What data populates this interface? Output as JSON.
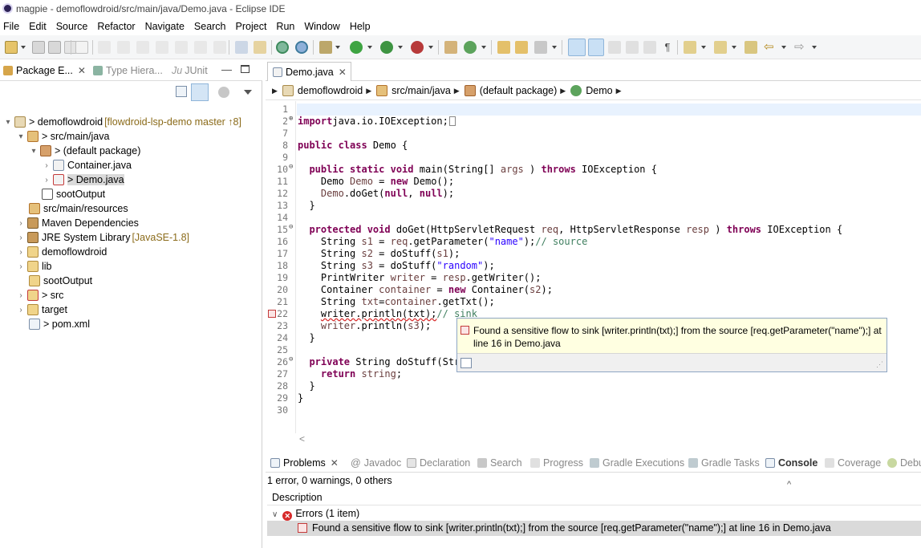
{
  "window": {
    "title": "magpie - demoflowdroid/src/main/java/Demo.java - Eclipse IDE"
  },
  "menu": [
    "File",
    "Edit",
    "Source",
    "Refactor",
    "Navigate",
    "Search",
    "Project",
    "Run",
    "Window",
    "Help"
  ],
  "left_panel": {
    "tabs": [
      {
        "label": "Package E...",
        "active": true
      },
      {
        "label": "Type Hiera...",
        "active": false
      },
      {
        "label": "JUnit",
        "active": false,
        "icon_text": "Ju"
      }
    ],
    "tree": [
      {
        "label": "> demoflowdroid",
        "decoration": "[flowdroid-lsp-demo master ↑8]",
        "arrow": "▾",
        "icon": "java-project-icon"
      },
      {
        "label": "> src/main/java",
        "arrow": "▾",
        "icon": "source-folder-icon"
      },
      {
        "label": "> (default package)",
        "arrow": "▾",
        "icon": "package-icon"
      },
      {
        "label": "Container.java",
        "arrow": "›",
        "icon": "java-file-icon"
      },
      {
        "label": "> Demo.java",
        "arrow": "›",
        "icon": "java-file-error-icon"
      },
      {
        "label": "sootOutput",
        "arrow": "",
        "icon": "folder-grid-icon"
      },
      {
        "label": "src/main/resources",
        "arrow": "",
        "icon": "source-folder-icon"
      },
      {
        "label": "Maven Dependencies",
        "arrow": "›",
        "icon": "library-icon"
      },
      {
        "label": "JRE System Library",
        "decoration": "[JavaSE-1.8]",
        "arrow": "›",
        "icon": "library-icon"
      },
      {
        "label": "demoflowdroid",
        "arrow": "›",
        "icon": "folder-icon"
      },
      {
        "label": "lib",
        "arrow": "›",
        "icon": "folder-icon"
      },
      {
        "label": "sootOutput",
        "arrow": "",
        "icon": "folder-icon"
      },
      {
        "label": "> src",
        "arrow": "›",
        "icon": "folder-error-icon"
      },
      {
        "label": "target",
        "arrow": "›",
        "icon": "folder-icon"
      },
      {
        "label": "> pom.xml",
        "arrow": "",
        "icon": "xml-file-icon"
      }
    ]
  },
  "editor": {
    "tab_label": "Demo.java",
    "breadcrumb": [
      "demoflowdroid",
      "src/main/java",
      "(default package)",
      "Demo"
    ],
    "lines": [
      {
        "n": "1",
        "m": "",
        "s": []
      },
      {
        "n": "2",
        "m": "⊕",
        "s": [
          [
            "kw",
            "import"
          ],
          [
            "",
            "java.io.IOException;"
          ],
          [
            "box",
            ""
          ]
        ]
      },
      {
        "n": "7",
        "m": "",
        "s": []
      },
      {
        "n": "8",
        "m": "",
        "s": [
          [
            "kw",
            "public class"
          ],
          [
            "",
            " Demo {"
          ]
        ]
      },
      {
        "n": "9",
        "m": "",
        "s": []
      },
      {
        "n": "10",
        "m": "⊖",
        "s": [
          [
            "",
            "  "
          ],
          [
            "kw",
            "public static void"
          ],
          [
            "",
            " main(String[] "
          ],
          [
            "var",
            "args"
          ],
          [
            "",
            " ) "
          ],
          [
            "kw",
            "throws"
          ],
          [
            "",
            " IOException {"
          ]
        ]
      },
      {
        "n": "11",
        "m": "",
        "s": [
          [
            "",
            "    Demo "
          ],
          [
            "var",
            "Demo"
          ],
          [
            "",
            " = "
          ],
          [
            "kw",
            "new"
          ],
          [
            "",
            " Demo();"
          ]
        ]
      },
      {
        "n": "12",
        "m": "",
        "s": [
          [
            "",
            "    "
          ],
          [
            "var",
            "Demo"
          ],
          [
            "",
            ".doGet("
          ],
          [
            "kw",
            "null"
          ],
          [
            "",
            ", "
          ],
          [
            "kw",
            "null"
          ],
          [
            "",
            ");"
          ]
        ]
      },
      {
        "n": "13",
        "m": "",
        "s": [
          [
            "",
            "  }"
          ]
        ]
      },
      {
        "n": "14",
        "m": "",
        "s": []
      },
      {
        "n": "15",
        "m": "⊖",
        "s": [
          [
            "",
            "  "
          ],
          [
            "kw",
            "protected void"
          ],
          [
            "",
            " doGet(HttpServletRequest "
          ],
          [
            "var",
            "req"
          ],
          [
            "",
            ", HttpServletResponse "
          ],
          [
            "var",
            "resp"
          ],
          [
            "",
            " ) "
          ],
          [
            "kw",
            "throws"
          ],
          [
            "",
            " IOException {"
          ]
        ]
      },
      {
        "n": "16",
        "m": "",
        "s": [
          [
            "",
            "    String "
          ],
          [
            "var",
            "s1"
          ],
          [
            "",
            " = "
          ],
          [
            "var",
            "req"
          ],
          [
            "",
            ".getParameter("
          ],
          [
            "str",
            "\"name\""
          ],
          [
            "",
            ");"
          ],
          [
            "cm",
            "// source"
          ]
        ]
      },
      {
        "n": "17",
        "m": "",
        "s": [
          [
            "",
            "    String "
          ],
          [
            "var",
            "s2"
          ],
          [
            "",
            " = doStuff("
          ],
          [
            "var",
            "s1"
          ],
          [
            "",
            ");"
          ]
        ]
      },
      {
        "n": "18",
        "m": "",
        "s": [
          [
            "",
            "    String "
          ],
          [
            "var",
            "s3"
          ],
          [
            "",
            " = doStuff("
          ],
          [
            "str",
            "\"random\""
          ],
          [
            "",
            ");"
          ]
        ]
      },
      {
        "n": "19",
        "m": "",
        "s": [
          [
            "",
            "    PrintWriter "
          ],
          [
            "var",
            "writer"
          ],
          [
            "",
            " = "
          ],
          [
            "var",
            "resp"
          ],
          [
            "",
            ".getWriter();"
          ]
        ]
      },
      {
        "n": "20",
        "m": "",
        "s": [
          [
            "",
            "    Container "
          ],
          [
            "var",
            "container"
          ],
          [
            "",
            " = "
          ],
          [
            "kw",
            "new"
          ],
          [
            "",
            " Container("
          ],
          [
            "var",
            "s2"
          ],
          [
            "",
            ");"
          ]
        ]
      },
      {
        "n": "21",
        "m": "",
        "s": [
          [
            "",
            "    String "
          ],
          [
            "var",
            "txt"
          ],
          [
            "",
            "="
          ],
          [
            "var",
            "container"
          ],
          [
            "",
            ".getTxt();"
          ]
        ]
      },
      {
        "n": "22",
        "m": "",
        "s": [
          [
            "",
            "    "
          ],
          [
            "squig",
            "writer.println(txt);"
          ],
          [
            "cm",
            "// sink"
          ]
        ]
      },
      {
        "n": "23",
        "m": "",
        "s": [
          [
            "",
            "    "
          ],
          [
            "var",
            "writer"
          ],
          [
            "",
            ".println("
          ],
          [
            "var",
            "s3"
          ],
          [
            "",
            ");"
          ]
        ]
      },
      {
        "n": "24",
        "m": "",
        "s": [
          [
            "",
            "  }"
          ]
        ]
      },
      {
        "n": "25",
        "m": "",
        "s": []
      },
      {
        "n": "26",
        "m": "⊖",
        "s": [
          [
            "",
            "  "
          ],
          [
            "kw",
            "private"
          ],
          [
            "",
            " String doStuff(Str"
          ]
        ]
      },
      {
        "n": "27",
        "m": "",
        "s": [
          [
            "",
            "    "
          ],
          [
            "kw",
            "return"
          ],
          [
            "",
            " "
          ],
          [
            "var",
            "string"
          ],
          [
            "",
            ";"
          ]
        ]
      },
      {
        "n": "28",
        "m": "",
        "s": [
          [
            "",
            "  }"
          ]
        ]
      },
      {
        "n": "29",
        "m": "",
        "s": [
          [
            "",
            "}"
          ]
        ]
      },
      {
        "n": "30",
        "m": "",
        "s": []
      }
    ]
  },
  "hover": {
    "message": "Found a sensitive flow to sink [writer.println(txt);] from the source [req.getParameter(\"name\");] at line 16 in Demo.java"
  },
  "bottom_panel": {
    "tabs": [
      "Problems",
      "Javadoc",
      "Declaration",
      "Search",
      "Progress",
      "Gradle Executions",
      "Gradle Tasks",
      "Console",
      "Coverage",
      "Debu"
    ],
    "summary": "1 error, 0 warnings, 0 others",
    "column_header": "Description",
    "group_label": "Errors (1 item)",
    "error_message": "Found a sensitive flow to sink [writer.println(txt);] from the source [req.getParameter(\"name\");] at line 16 in Demo.java"
  },
  "colors": {
    "keyword": "#7f0055",
    "string": "#2a00ff",
    "comment": "#3f7f5f",
    "variable": "#6a3e3e",
    "error": "#d72a2a",
    "hover_bg": "#ffffe1",
    "current_line": "#e8f2fe"
  }
}
